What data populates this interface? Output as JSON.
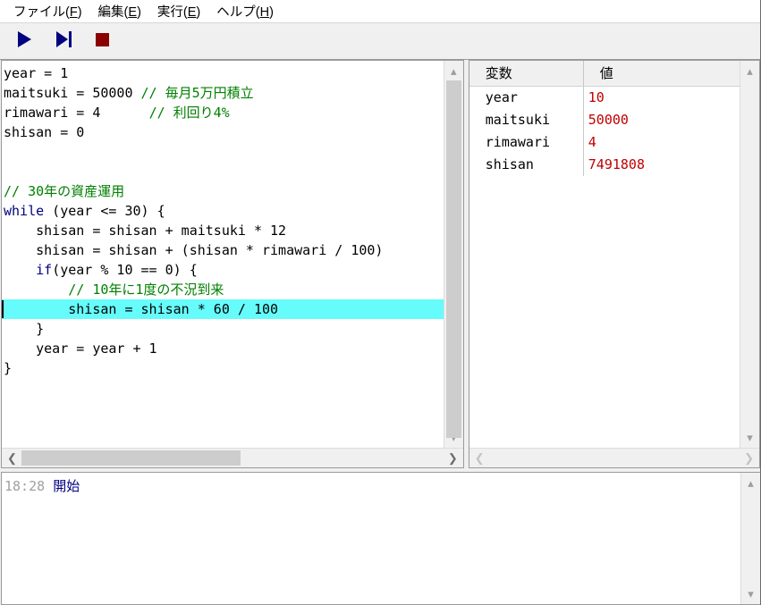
{
  "menubar": {
    "items": [
      {
        "label": "ファイル",
        "accel": "F"
      },
      {
        "label": "編集",
        "accel": "E"
      },
      {
        "label": "実行",
        "accel": "E"
      },
      {
        "label": "ヘルプ",
        "accel": "H"
      }
    ]
  },
  "toolbar": {
    "buttons": [
      {
        "name": "run-button",
        "icon": "play-icon",
        "color": "#000080"
      },
      {
        "name": "step-button",
        "icon": "step-forward-icon",
        "color": "#000080"
      },
      {
        "name": "stop-button",
        "icon": "stop-square-icon",
        "color": "#8B0000"
      }
    ]
  },
  "editor": {
    "lines": [
      {
        "segments": [
          {
            "t": "year = 1",
            "c": "plain"
          }
        ]
      },
      {
        "segments": [
          {
            "t": "maitsuki = 50000 ",
            "c": "plain"
          },
          {
            "t": "// 毎月5万円積立",
            "c": "comment"
          }
        ]
      },
      {
        "segments": [
          {
            "t": "rimawari = 4      ",
            "c": "plain"
          },
          {
            "t": "// 利回り4%",
            "c": "comment"
          }
        ]
      },
      {
        "segments": [
          {
            "t": "shisan = 0",
            "c": "plain"
          }
        ]
      },
      {
        "segments": [
          {
            "t": "",
            "c": "plain"
          }
        ]
      },
      {
        "segments": [
          {
            "t": "",
            "c": "plain"
          }
        ]
      },
      {
        "segments": [
          {
            "t": "// 30年の資産運用",
            "c": "comment"
          }
        ]
      },
      {
        "segments": [
          {
            "t": "while",
            "c": "keyword"
          },
          {
            "t": " (year <= 30) {",
            "c": "plain"
          }
        ]
      },
      {
        "segments": [
          {
            "t": "    shisan = shisan + maitsuki * 12",
            "c": "plain"
          }
        ]
      },
      {
        "segments": [
          {
            "t": "    shisan = shisan + (shisan * rimawari / 100)",
            "c": "plain"
          }
        ]
      },
      {
        "segments": [
          {
            "t": "    ",
            "c": "plain"
          },
          {
            "t": "if",
            "c": "keyword"
          },
          {
            "t": "(year % 10 == 0) {",
            "c": "plain"
          }
        ]
      },
      {
        "segments": [
          {
            "t": "        // 10年に1度の不況到来",
            "c": "comment"
          }
        ]
      },
      {
        "highlight": true,
        "cursor": true,
        "segments": [
          {
            "t": "        shisan = shisan * 60 / 100",
            "c": "plain"
          }
        ]
      },
      {
        "segments": [
          {
            "t": "    }",
            "c": "plain"
          }
        ]
      },
      {
        "segments": [
          {
            "t": "    year = year + 1",
            "c": "plain"
          }
        ]
      },
      {
        "segments": [
          {
            "t": "}",
            "c": "plain"
          }
        ]
      }
    ],
    "scroll": {
      "up_arrow": "︿",
      "down_arrow": "﹀",
      "left_arrow": "❮",
      "right_arrow": "❯"
    }
  },
  "variables": {
    "headers": {
      "name": "変数",
      "value": "値"
    },
    "rows": [
      {
        "name": "year",
        "value": "10"
      },
      {
        "name": "maitsuki",
        "value": "50000"
      },
      {
        "name": "rimawari",
        "value": "4"
      },
      {
        "name": "shisan",
        "value": "7491808"
      }
    ],
    "value_color": "#c00000"
  },
  "console": {
    "entries": [
      {
        "time": "18:28",
        "message": "開始"
      }
    ]
  }
}
